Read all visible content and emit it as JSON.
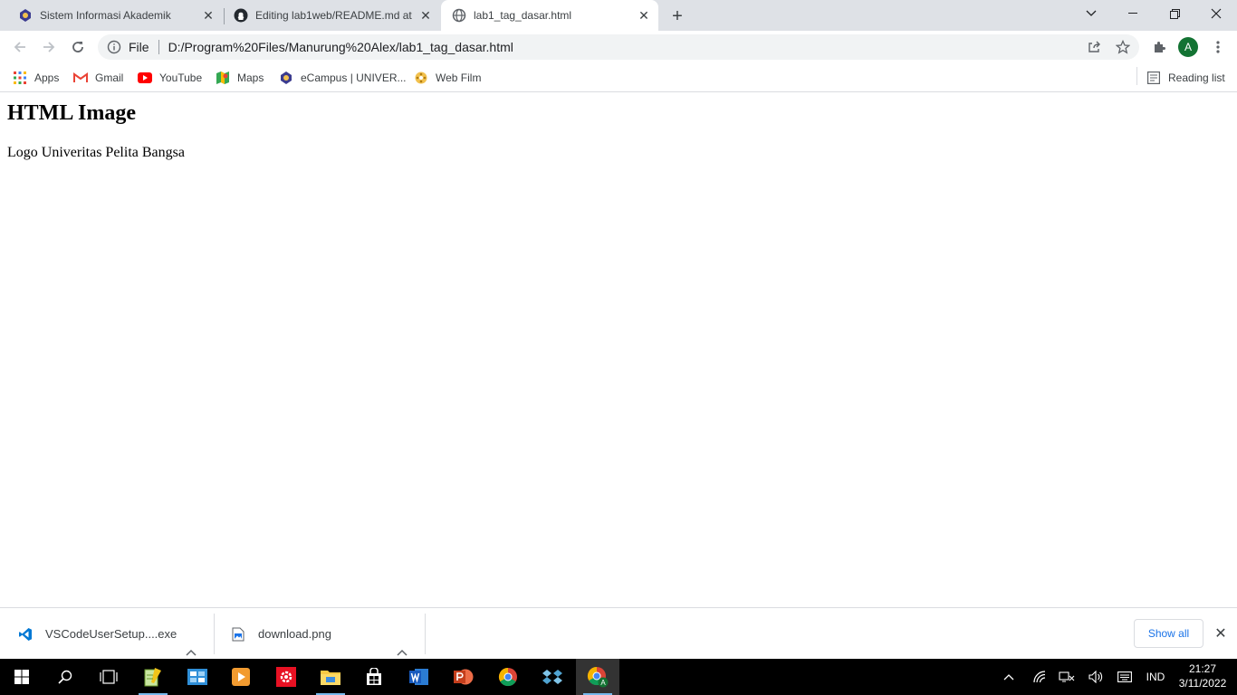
{
  "tabs": [
    {
      "title": "Sistem Informasi Akademik",
      "icon": "university-logo-icon",
      "active": false
    },
    {
      "title": "Editing lab1web/README.md at",
      "icon": "github-icon",
      "active": false
    },
    {
      "title": "lab1_tag_dasar.html",
      "icon": "globe-icon",
      "active": true
    }
  ],
  "omnibox": {
    "scheme": "File",
    "url": "D:/Program%20Files/Manurung%20Alex/lab1_tag_dasar.html"
  },
  "profile": {
    "initial": "A"
  },
  "bookmarks": [
    {
      "label": "Apps",
      "icon": "apps-grid-icon"
    },
    {
      "label": "Gmail",
      "icon": "gmail-icon"
    },
    {
      "label": "YouTube",
      "icon": "youtube-icon"
    },
    {
      "label": "Maps",
      "icon": "maps-icon"
    },
    {
      "label": "eCampus | UNIVER...",
      "icon": "university-logo-icon"
    },
    {
      "label": "Web Film",
      "icon": "film-icon"
    }
  ],
  "reading_list": {
    "label": "Reading list"
  },
  "page": {
    "heading": "HTML Image",
    "image_alt": "Logo Univeritas Pelita Bangsa"
  },
  "downloads": {
    "items": [
      {
        "name": "VSCodeUserSetup....exe",
        "icon": "vscode-icon"
      },
      {
        "name": "download.png",
        "icon": "image-file-icon"
      }
    ],
    "show_all": "Show all"
  },
  "taskbar": {
    "lang": "IND",
    "time": "21:27",
    "date": "3/11/2022"
  },
  "colors": {
    "tabstrip": "#dee1e6",
    "omnibox": "#f1f3f4",
    "accent": "#1a73e8",
    "taskbar": "#000000"
  }
}
